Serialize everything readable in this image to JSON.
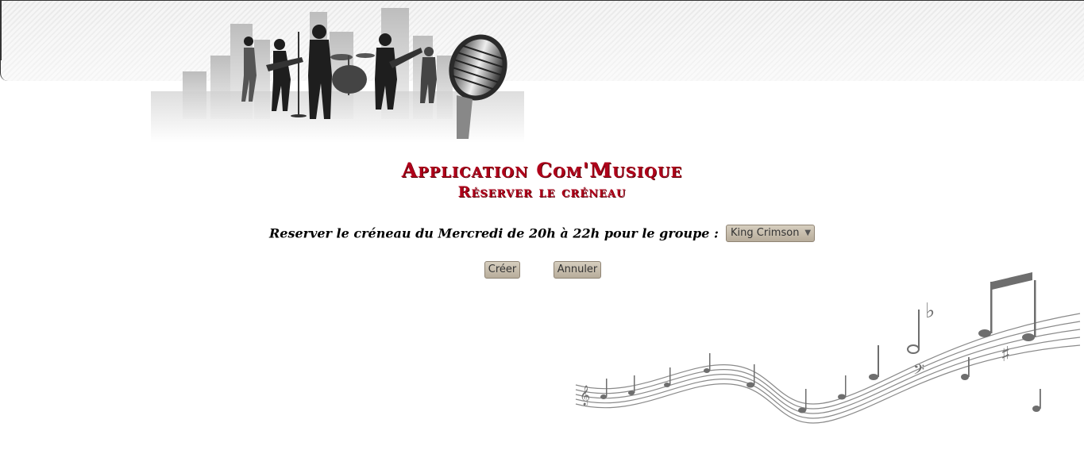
{
  "header": {
    "app_title": "Application Com'Musique",
    "page_title": "Réserver le créneau"
  },
  "form": {
    "label": "Reserver le créneau du Mercredi de 20h à 22h pour le groupe :",
    "group_select": {
      "selected": "King Crimson"
    },
    "buttons": {
      "create": "Créer",
      "cancel": "Annuler"
    }
  },
  "colors": {
    "title_red": "#b0001a",
    "button_bg": "#c8bfb0"
  },
  "images": {
    "banner": "band-silhouette-microphone-banner",
    "decoration": "music-staff-notes-decoration"
  }
}
